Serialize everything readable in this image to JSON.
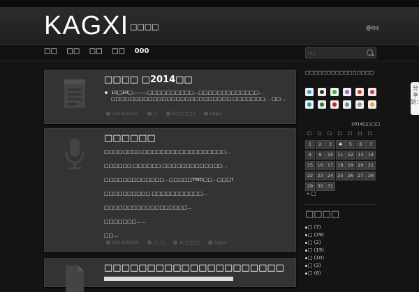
{
  "site": {
    "title": "KAGXI",
    "tagline": "□□□□",
    "header_link": "@qq"
  },
  "nav": {
    "items": [
      "□□",
      "□□",
      "□□",
      "□□",
      "000"
    ],
    "search_placeholder": "□□"
  },
  "posts": [
    {
      "title": "□□□□ □2014□□",
      "body": [
        "10□30□———□□□□□□□□□□…□□□□□□□□□□□□□…□□□□□□□□□□□□□□□□□□□□□□□□□□.□□□□□□□… □□…"
      ],
      "meta": {
        "date": "2014/10/31",
        "category": "□",
        "comments": "87□□□□",
        "author": "kagxi"
      },
      "icon": "notepad-icon"
    },
    {
      "title": "□□□□□□",
      "body": [
        "□□□□□□□□.□□□□□□□□□□□□□□□□□□…",
        "□□□□□□.□□□□□□.□□□□□□□□□□□□□…",
        "□□□□□□□□□□□□□…□□□□□TMD□□…□□□?",
        "□□□□□□□□□□.□□□□□□□□□□□…",
        "□□□□□□□□□□□□□□□□□□…",
        "□□□□□□□……",
        "□□…"
      ],
      "meta": {
        "date": "2014/09/24",
        "category": "□, □",
        "comments": "6□□□□",
        "author": "kagxi"
      },
      "icon": "microphone-icon"
    },
    {
      "title": "□□□□□□□□□□□□□□□□□□□□□",
      "body": [],
      "meta": {},
      "icon": "document-icon"
    }
  ],
  "sidebar": {
    "share_text": "□□□□□□□□□□□□□□□□",
    "social_colors": [
      "#3aa3e3",
      "#333333",
      "#3fb03f",
      "#b05ec2",
      "#e03a3a",
      "#d9343c",
      "#1fa3b3",
      "#2a7a3a",
      "#c21f1f",
      "#7a86b0",
      "#999999",
      "#e0b020"
    ],
    "calendar": {
      "title": "2014□□□□",
      "weekdays": [
        "□",
        "□",
        "□",
        "□",
        "□",
        "□",
        "□"
      ],
      "days": [
        1,
        2,
        3,
        4,
        5,
        6,
        7,
        8,
        9,
        10,
        11,
        12,
        13,
        14,
        15,
        16,
        17,
        18,
        19,
        20,
        21,
        22,
        23,
        24,
        25,
        26,
        27,
        28,
        29,
        30,
        31
      ],
      "today": 4,
      "prev": "« □"
    },
    "categories_heading": "□□□□",
    "categories": [
      {
        "name": "□",
        "count": "(7)"
      },
      {
        "name": "□",
        "count": "(29)"
      },
      {
        "name": "□",
        "count": "(2)"
      },
      {
        "name": "□",
        "count": "(19)"
      },
      {
        "name": "□",
        "count": "(10)"
      },
      {
        "name": "□",
        "count": "(3)"
      },
      {
        "name": "□",
        "count": "(6)"
      }
    ]
  },
  "share_widget": {
    "label": "分享到："
  }
}
